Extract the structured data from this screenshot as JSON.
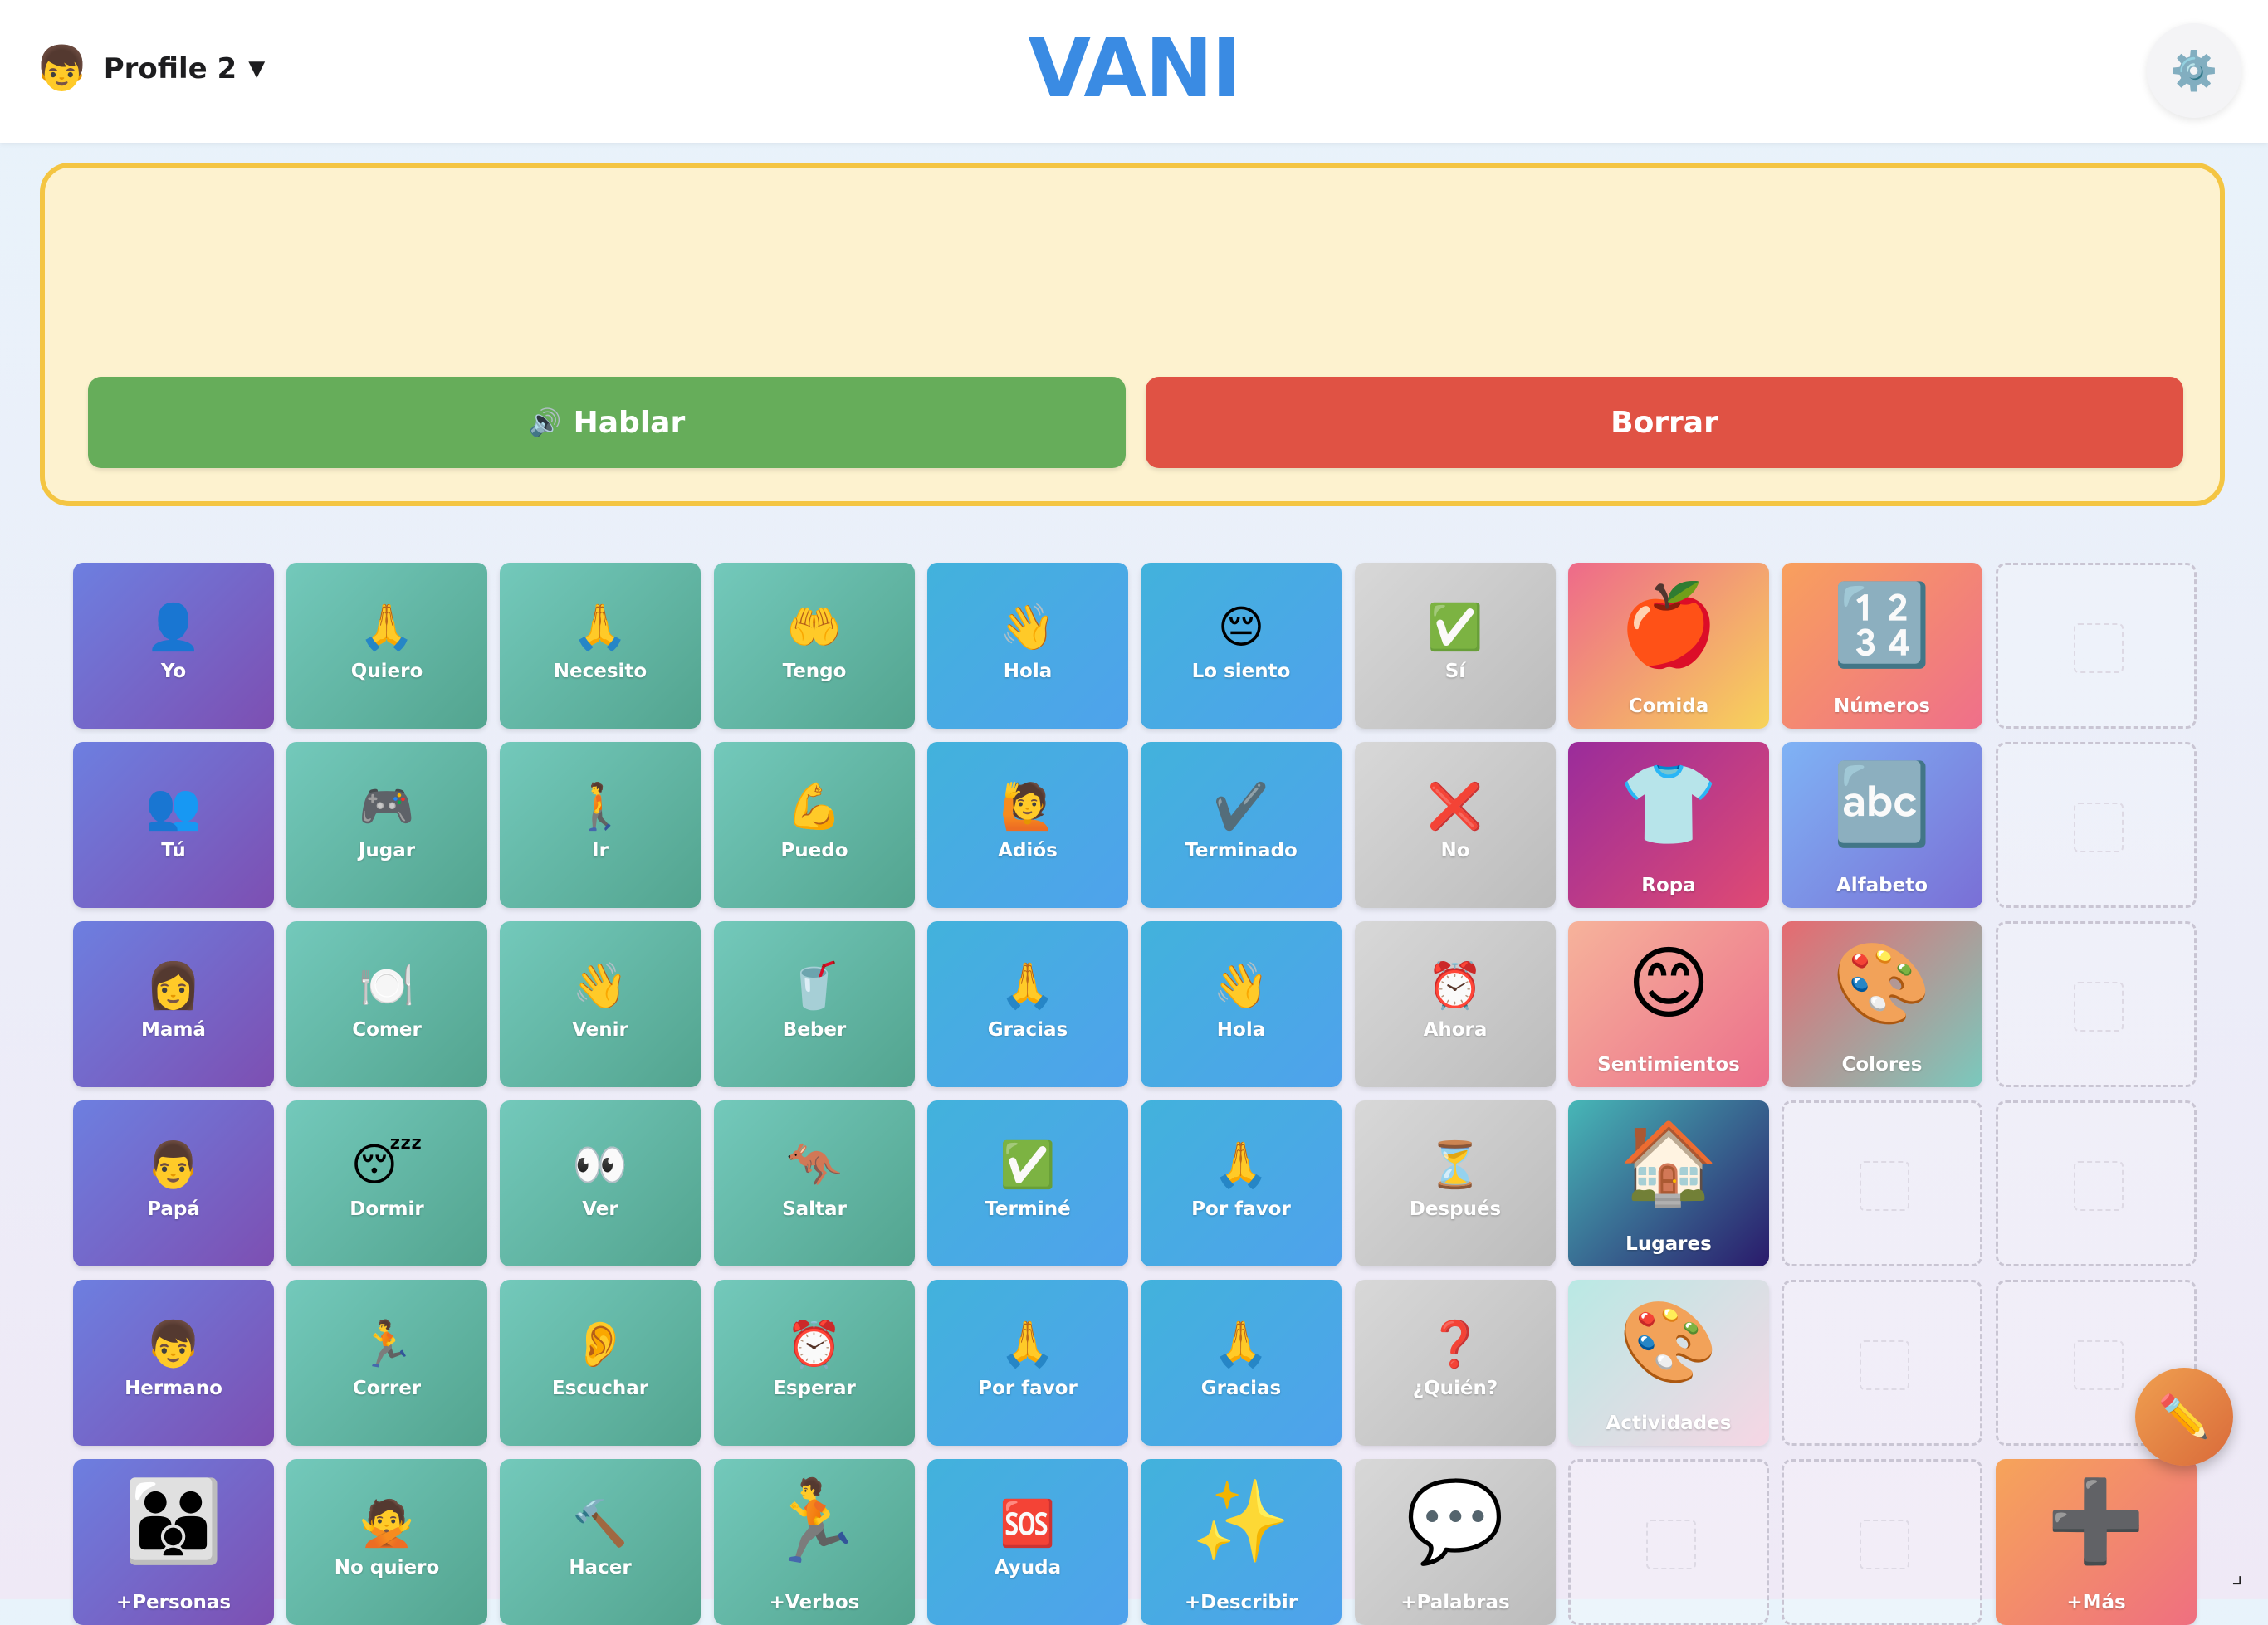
{
  "header": {
    "profile": {
      "emoji": "👦",
      "name": "Profile 2",
      "caret": "▼"
    },
    "title": "VANI",
    "settings_icon": "⚙️"
  },
  "composer": {
    "sentence": "",
    "speak_icon": "🔊",
    "speak_label": "Hablar",
    "clear_label": "Borrar"
  },
  "board": {
    "tiles": [
      {
        "icon": "👤",
        "label": "Yo"
      },
      {
        "icon": "🙏",
        "label": "Quiero"
      },
      {
        "icon": "🙏",
        "label": "Necesito"
      },
      {
        "icon": "🤲",
        "label": "Tengo"
      },
      {
        "icon": "👋",
        "label": "Hola"
      },
      {
        "icon": "😔",
        "label": "Lo siento"
      },
      {
        "icon": "✅",
        "label": "Sí"
      },
      {
        "icon": "🍎",
        "label": "Comida"
      },
      {
        "icon": "🔢",
        "label": "Números"
      },
      {
        "icon": "👥",
        "label": "Tú"
      },
      {
        "icon": "🎮",
        "label": "Jugar"
      },
      {
        "icon": "🚶",
        "label": "Ir"
      },
      {
        "icon": "💪",
        "label": "Puedo"
      },
      {
        "icon": "🙋",
        "label": "Adiós"
      },
      {
        "icon": "✔️",
        "label": "Terminado"
      },
      {
        "icon": "❌",
        "label": "No"
      },
      {
        "icon": "👕",
        "label": "Ropa"
      },
      {
        "icon": "🔤",
        "label": "Alfabeto"
      },
      {
        "icon": "👩",
        "label": "Mamá"
      },
      {
        "icon": "🍽️",
        "label": "Comer"
      },
      {
        "icon": "👋",
        "label": "Venir"
      },
      {
        "icon": "🥤",
        "label": "Beber"
      },
      {
        "icon": "🙏",
        "label": "Gracias"
      },
      {
        "icon": "👋",
        "label": "Hola"
      },
      {
        "icon": "⏰",
        "label": "Ahora"
      },
      {
        "icon": "😊",
        "label": "Sentimientos"
      },
      {
        "icon": "🎨",
        "label": "Colores"
      },
      {
        "icon": "👨",
        "label": "Papá"
      },
      {
        "icon": "😴",
        "label": "Dormir"
      },
      {
        "icon": "👀",
        "label": "Ver"
      },
      {
        "icon": "🦘",
        "label": "Saltar"
      },
      {
        "icon": "✅",
        "label": "Terminé"
      },
      {
        "icon": "🙏",
        "label": "Por favor"
      },
      {
        "icon": "⏳",
        "label": "Después"
      },
      {
        "icon": "🏠",
        "label": "Lugares"
      },
      {
        "icon": "👦",
        "label": "Hermano"
      },
      {
        "icon": "🏃",
        "label": "Correr"
      },
      {
        "icon": "👂",
        "label": "Escuchar"
      },
      {
        "icon": "⏰",
        "label": "Esperar"
      },
      {
        "icon": "🙏",
        "label": "Por favor"
      },
      {
        "icon": "🙏",
        "label": "Gracias"
      },
      {
        "icon": "❓",
        "label": "¿Quién?"
      },
      {
        "icon": "🎨",
        "label": "Actividades"
      },
      {
        "icon": "👪",
        "label": "+Personas"
      },
      {
        "icon": "🙅",
        "label": "No quiero"
      },
      {
        "icon": "🔨",
        "label": "Hacer"
      },
      {
        "icon": "🏃",
        "label": "+Verbos"
      },
      {
        "icon": "🆘",
        "label": "Ayuda"
      },
      {
        "icon": "✨",
        "label": "+Describir"
      },
      {
        "icon": "💬",
        "label": "+Palabras"
      },
      {
        "icon": "➕",
        "label": "+Más"
      }
    ]
  },
  "edit_icon": "✏️",
  "resize_icon": "⌟"
}
